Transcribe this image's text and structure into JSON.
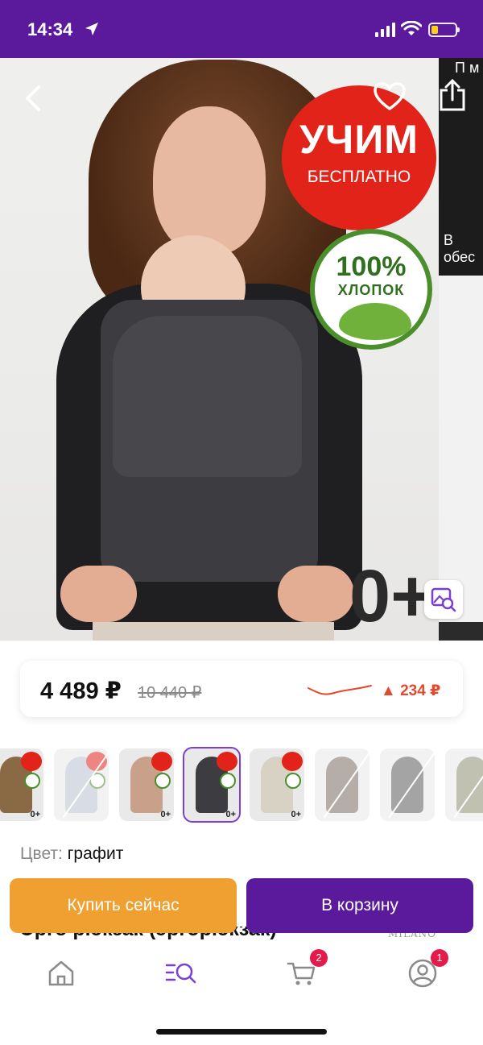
{
  "status_bar": {
    "time": "14:34",
    "battery_level": 0.25,
    "battery_color": "#f7d21b",
    "background": "#5b1a9c"
  },
  "gallery": {
    "promo_badge_main": "УЧИМ",
    "promo_badge_sub": "БЕСПЛАТНО",
    "cotton_badge_percent": "100%",
    "cotton_badge_label": "ХЛОПОК",
    "age_label": "0+",
    "next_image_text_top": "П м",
    "next_image_text_bottom": "В обес"
  },
  "price": {
    "current": "4 489 ₽",
    "old": "10 440 ₽",
    "delta": "▲ 234 ₽",
    "delta_color": "#e4492e"
  },
  "thumbnails": [
    {
      "color": "#8a6a45",
      "age": "0+",
      "selected": false,
      "available": true,
      "promo": "УЧИМ"
    },
    {
      "color": "#b9c3d1",
      "age": "",
      "selected": false,
      "available": false,
      "promo": "УЧИМ"
    },
    {
      "color": "#c9a089",
      "age": "0+",
      "selected": false,
      "available": true,
      "promo": "УЧИМ"
    },
    {
      "color": "#3d3c40",
      "age": "0+",
      "selected": true,
      "available": true,
      "promo": "УЧИМ"
    },
    {
      "color": "#d8d2c4",
      "age": "0+",
      "selected": false,
      "available": true,
      "promo": "УЧИМ"
    },
    {
      "color": "#7a6d62",
      "age": "",
      "selected": false,
      "available": false,
      "promo": ""
    },
    {
      "color": "#5a5a5a",
      "age": "",
      "selected": false,
      "available": false,
      "promo": ""
    },
    {
      "color": "#8d8f72",
      "age": "",
      "selected": false,
      "available": false,
      "promo": ""
    }
  ],
  "color_selection": {
    "label": "Цвет:",
    "value": "графит"
  },
  "actions": {
    "buy_now": "Купить сейчас",
    "add_to_cart": "В корзину"
  },
  "product": {
    "title": "Эрго рюкзак (эргорюкзак)",
    "brand": "MILANO"
  },
  "tabbar": {
    "accent_color": "#7a3fd1",
    "cart_badge": "2",
    "profile_badge": "1",
    "icons": [
      "home-icon",
      "catalog-search-icon",
      "cart-icon",
      "profile-icon"
    ]
  }
}
